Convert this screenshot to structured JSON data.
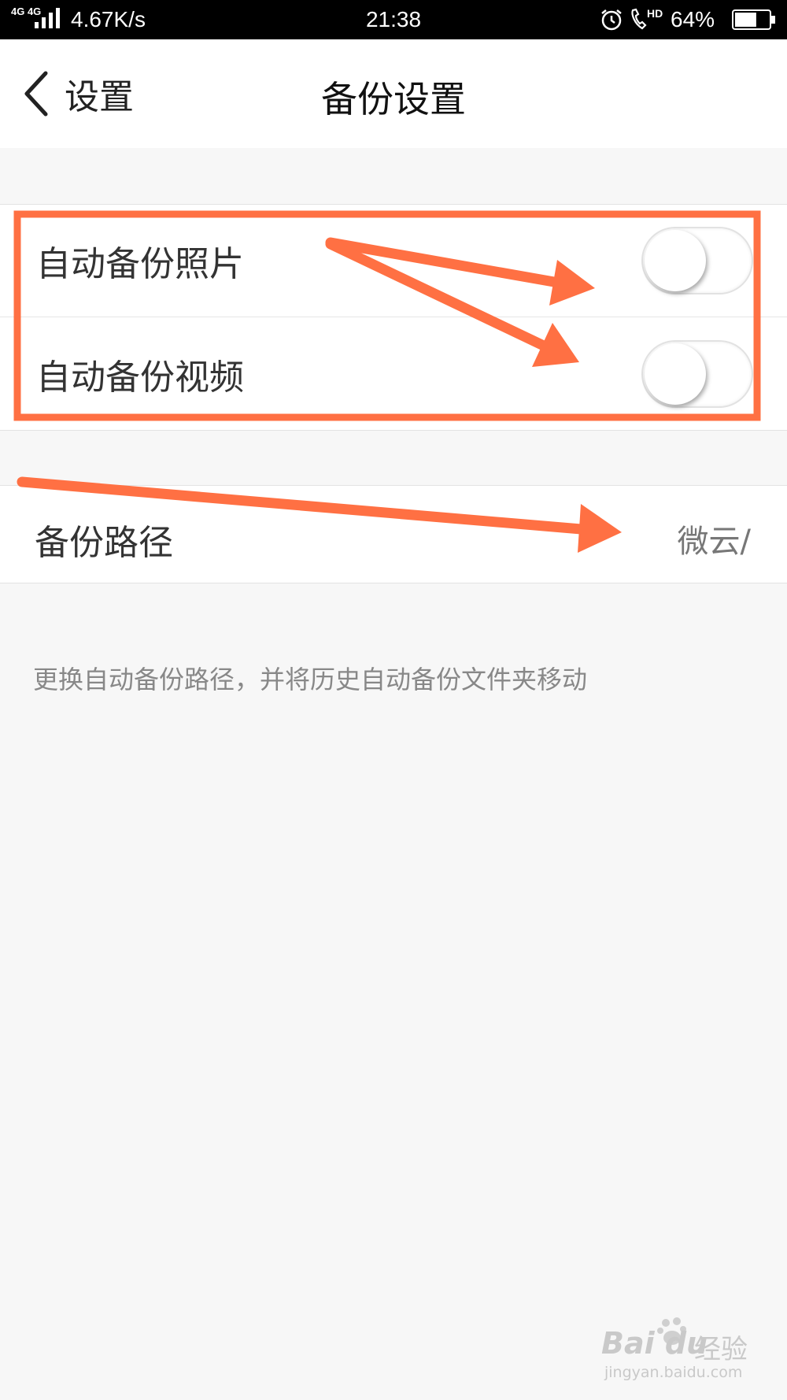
{
  "status_bar": {
    "network_type": "4G 4G",
    "net_speed": "4.67K/s",
    "time": "21:38",
    "hd_label": "HD",
    "battery_percent": "64%",
    "battery_level": 0.64
  },
  "nav": {
    "back_label": "设置",
    "title": "备份设置"
  },
  "settings": {
    "auto_backup_photos": {
      "label": "自动备份照片",
      "enabled": false
    },
    "auto_backup_videos": {
      "label": "自动备份视频",
      "enabled": false
    },
    "backup_path": {
      "label": "备份路径",
      "value": "微云/"
    }
  },
  "hint": "更换自动备份路径，并将历史自动备份文件夹移动",
  "annotation_color": "#ff7043",
  "watermark": {
    "main": "Bai du",
    "cn": "经验",
    "url": "jingyan.baidu.com"
  },
  "icons": [
    "signal-icon",
    "alarm-icon",
    "call-icon",
    "battery-icon",
    "chevron-left-icon",
    "paw-icon"
  ]
}
